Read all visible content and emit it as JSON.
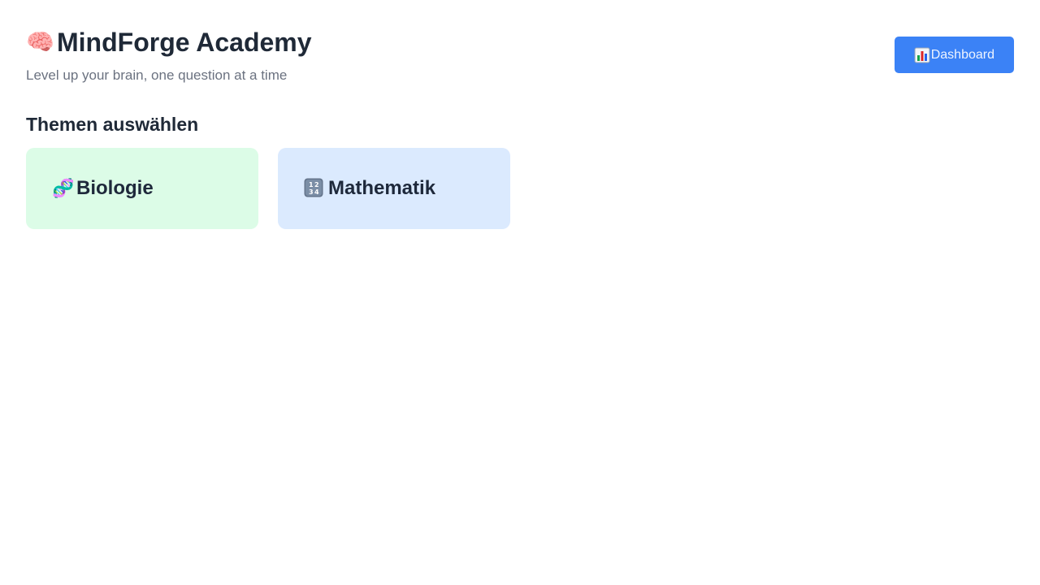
{
  "header": {
    "title": "MindForge Academy",
    "subtitle": "Level up your brain, one question at a time",
    "title_icon": "brain-icon"
  },
  "toolbar": {
    "dashboard_label": "Dashboard",
    "dashboard_icon": "bar-chart-icon"
  },
  "main": {
    "section_heading": "Themen auswählen",
    "topics": [
      {
        "label": "Biologie",
        "icon": "dna-icon",
        "color": "#dcfce7"
      },
      {
        "label": "Mathematik",
        "icon": "numbers-keycap-icon",
        "color": "#dbeafe"
      }
    ]
  },
  "colors": {
    "accent": "#3b82f6",
    "text": "#1f2937",
    "muted": "#6b7280"
  }
}
